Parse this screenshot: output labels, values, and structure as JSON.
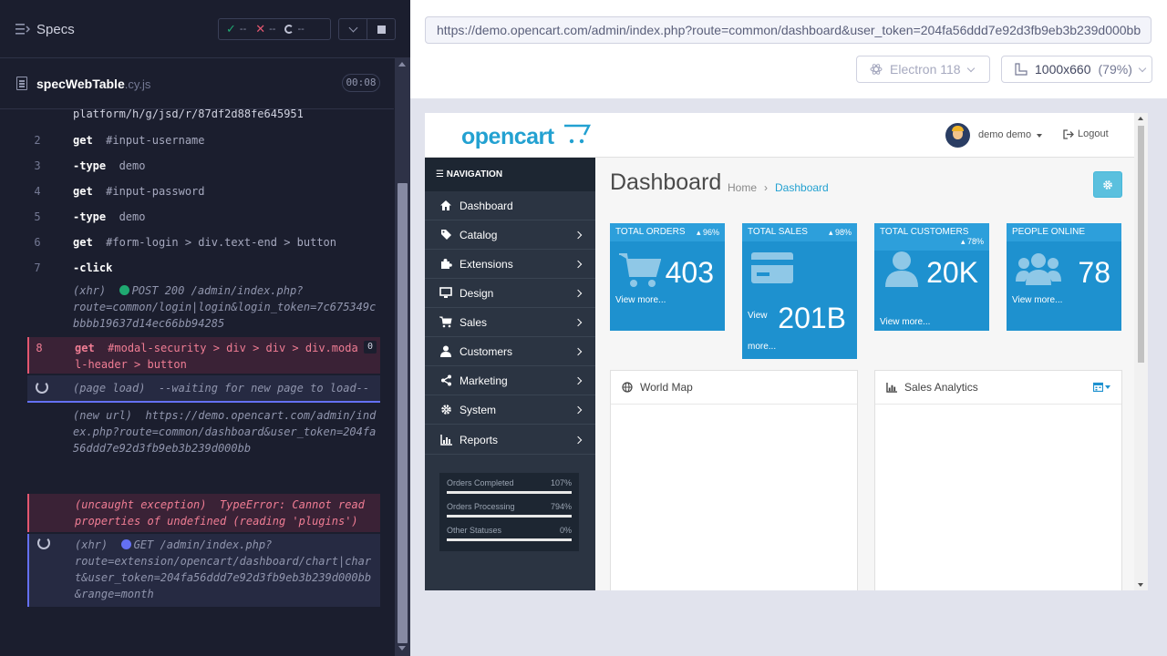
{
  "runner": {
    "specs_title": "Specs",
    "stats": {
      "passed": "--",
      "failed": "--",
      "pending": "--"
    },
    "spec": {
      "name": "specWebTable",
      "ext": ".cy.js",
      "duration": "00:08"
    },
    "commands": [
      {
        "num": "",
        "name": "",
        "text": "platform/h/g/jsd/r/87df2d88fe645951"
      },
      {
        "num": "2",
        "name": "get",
        "text": "#input-username"
      },
      {
        "num": "3",
        "name": "-type",
        "text": "demo"
      },
      {
        "num": "4",
        "name": "get",
        "text": "#input-password"
      },
      {
        "num": "5",
        "name": "-type",
        "text": "demo"
      },
      {
        "num": "6",
        "name": "get",
        "text": "#form-login > div.text-end > button"
      },
      {
        "num": "7",
        "name": "-click",
        "text": ""
      }
    ],
    "xhr1": {
      "label": "(xhr)",
      "method": "POST 200 /admin/index.php?",
      "url": "route=common/login|login&login_token=7c675349cbbbb19637d14ec66bb94285"
    },
    "failed": {
      "num": "8",
      "name": "get",
      "text": "#modal-security > div > div > div.modal-header > button",
      "count": "0"
    },
    "pageload": {
      "label": "(page load)",
      "text": "--waiting for new page to load--"
    },
    "newurl": {
      "label": "(new url)",
      "text": "https://demo.opencart.com/admin/index.php?route=common/dashboard&user_token=204fa56ddd7e92d3fb9eb3b239d000bb"
    },
    "exception": {
      "label": "(uncaught exception)",
      "text": "TypeError: Cannot read properties of undefined (reading 'plugins')"
    },
    "xhr2": {
      "label": "(xhr)",
      "method": "GET /admin/index.php?",
      "url": "route=extension/opencart/dashboard/chart|chart&user_token=204fa56ddd7e92d3fb9eb3b239d000bb&range=month"
    }
  },
  "browser": {
    "url": "https://demo.opencart.com/admin/index.php?route=common/dashboard&user_token=204fa56ddd7e92d3fb9eb3b239d000bb",
    "name": "Electron 118",
    "viewport": "1000x660",
    "scale": "(79%)"
  },
  "opencart": {
    "logo": "opencart",
    "user": "demo demo",
    "logout": "Logout",
    "nav_title": "NAVIGATION",
    "nav": [
      {
        "label": "Dashboard",
        "icon": "dashboard-icon",
        "arrow": false
      },
      {
        "label": "Catalog",
        "icon": "tag-icon",
        "arrow": true
      },
      {
        "label": "Extensions",
        "icon": "puzzle-icon",
        "arrow": true
      },
      {
        "label": "Design",
        "icon": "monitor-icon",
        "arrow": true
      },
      {
        "label": "Sales",
        "icon": "cart-icon",
        "arrow": true
      },
      {
        "label": "Customers",
        "icon": "user-icon",
        "arrow": true
      },
      {
        "label": "Marketing",
        "icon": "share-icon",
        "arrow": true
      },
      {
        "label": "System",
        "icon": "cog-icon",
        "arrow": true
      },
      {
        "label": "Reports",
        "icon": "bar-chart-icon",
        "arrow": true
      }
    ],
    "stats": [
      {
        "label": "Orders Completed",
        "value": "107%"
      },
      {
        "label": "Orders Processing",
        "value": "794%"
      },
      {
        "label": "Other Statuses",
        "value": "0%"
      }
    ],
    "page_title": "Dashboard",
    "breadcrumb": [
      "Home",
      "Dashboard"
    ],
    "tiles": [
      {
        "title": "TOTAL ORDERS",
        "pct": "96%",
        "value": "403",
        "footer": "View more..."
      },
      {
        "title": "TOTAL SALES",
        "pct": "98%",
        "value": "201B",
        "footer_a": "View",
        "footer_b": "more..."
      },
      {
        "title": "TOTAL CUSTOMERS",
        "pct": "78%",
        "value": "20K",
        "footer": "View more..."
      },
      {
        "title": "PEOPLE ONLINE",
        "pct": "",
        "value": "78",
        "footer": "View more..."
      }
    ],
    "world_map": "World Map",
    "sales_analytics": "Sales Analytics",
    "colors": {
      "tile": "#1e91cf",
      "nav": "#2b3442",
      "accent": "#23a1d1"
    }
  }
}
